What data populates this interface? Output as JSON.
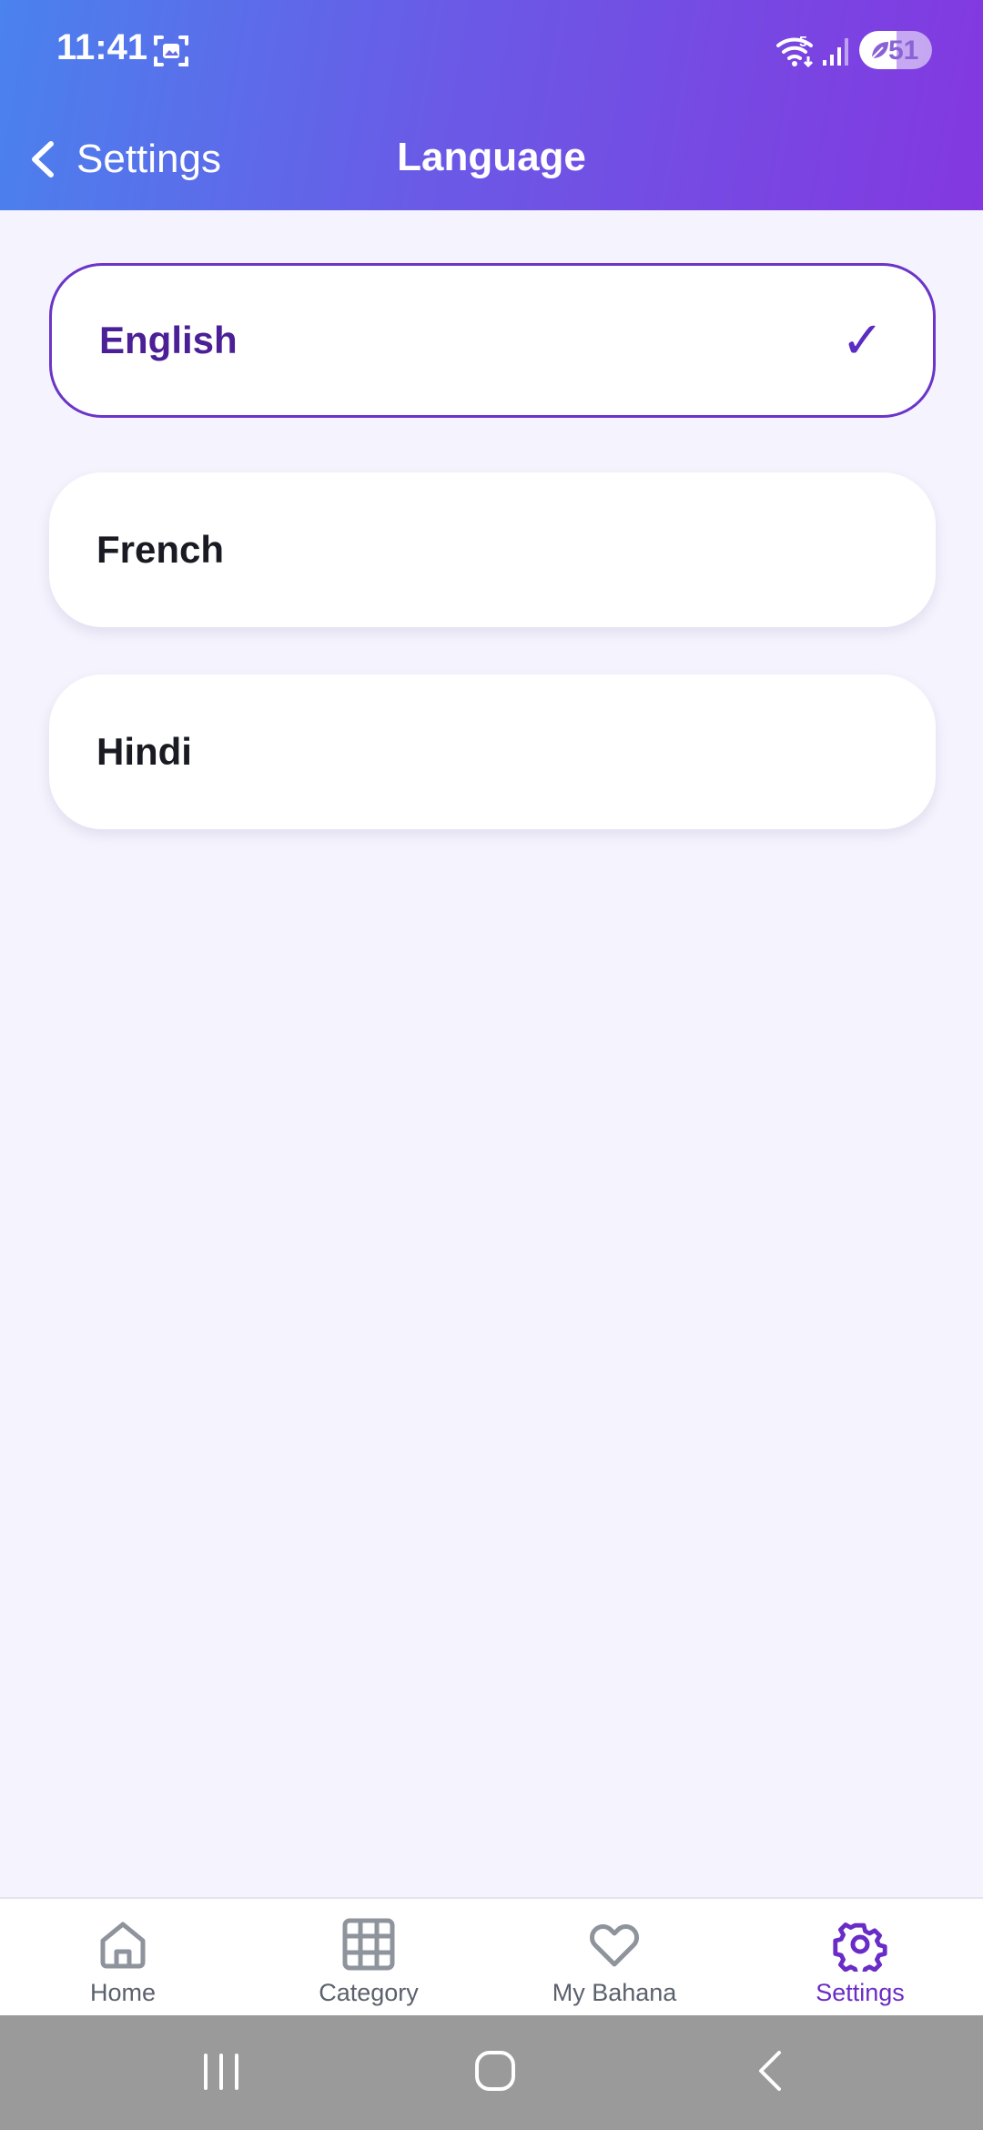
{
  "status_bar": {
    "time": "11:41",
    "wifi_sub": "5",
    "battery_level": "51",
    "battery_fraction": 0.51,
    "icons": [
      "screenshot-icon",
      "wifi-icon",
      "signal-icon",
      "battery-icon"
    ]
  },
  "header": {
    "back_label": "Settings",
    "title": "Language"
  },
  "languages": [
    {
      "label": "English",
      "selected": true
    },
    {
      "label": "French",
      "selected": false
    },
    {
      "label": "Hindi",
      "selected": false
    }
  ],
  "check_mark": "✓",
  "bottom_nav": {
    "items": [
      {
        "label": "Home",
        "icon": "home-icon",
        "active": false
      },
      {
        "label": "Category",
        "icon": "grid-icon",
        "active": false
      },
      {
        "label": "My Bahana",
        "icon": "heart-icon",
        "active": false
      },
      {
        "label": "Settings",
        "icon": "gear-icon",
        "active": true
      }
    ]
  },
  "colors": {
    "header_gradient_start": "#4a82ee",
    "header_gradient_end": "#8338e0",
    "accent": "#6a2cc6",
    "background": "#f5f3fd",
    "inactive_nav": "#8e939c"
  }
}
